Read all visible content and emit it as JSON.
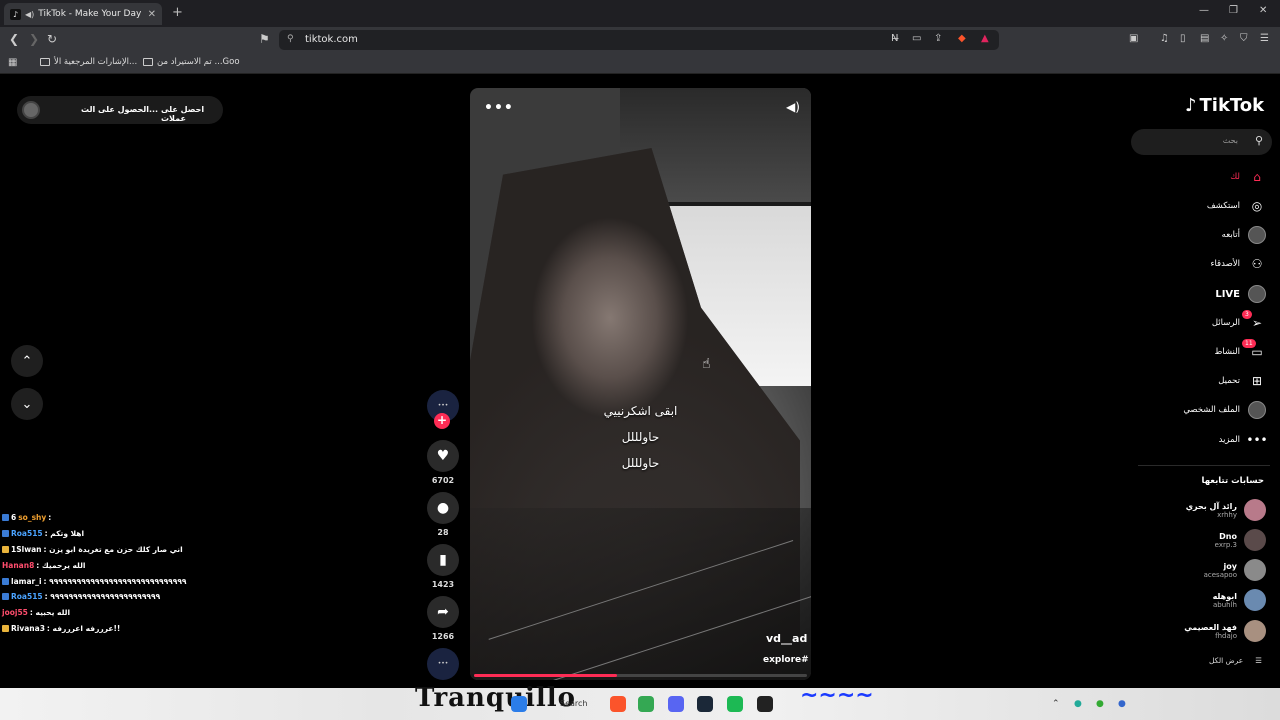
{
  "browser": {
    "tab_title": "TikTok - Make Your Day",
    "new_tab": "+",
    "url": "tiktok.com",
    "window_controls": {
      "minimize": "—",
      "restore": "❐",
      "close": "✕"
    },
    "bookmarks": [
      {
        "label": "تم الاستيراد من ...Goo"
      },
      {
        "label": "الإشارات المرجعية الأ..."
      }
    ]
  },
  "left_panel": {
    "get_coins": "احصل على عملات",
    "get_coins_2": "الحصول على الت...",
    "nav_up": "⌃",
    "nav_down": "⌄"
  },
  "video": {
    "caption_lines": [
      "ابقى اشكرنييي",
      "حاولللل",
      "حاولللل"
    ],
    "author": "vd__ad",
    "tag": "explore#",
    "progress": 0.43,
    "more": "•••"
  },
  "actions": {
    "likes": "6702",
    "comments": "28",
    "saves": "1423",
    "shares": "1266"
  },
  "chat": [
    {
      "prefix": "6",
      "user": "so_shy",
      "user_color": "#f0a030",
      "text": ":",
      "badge": "b1"
    },
    {
      "prefix": "",
      "user": "Roa515",
      "user_color": "#4aa3ff",
      "text": ": اهلا وتكم",
      "badge": "b1"
    },
    {
      "prefix": "",
      "user": "1Slwan",
      "user_color": "#ffffff",
      "text": ": اني صار كلك حزن مع تغريدة ابو يزن",
      "badge": "b2"
    },
    {
      "prefix": "",
      "user": "Hanan8",
      "user_color": "#ff4d6d",
      "text": ": الله يرحميك",
      "badge": ""
    },
    {
      "prefix": "",
      "user": "lamar_i",
      "user_color": "#ffffff",
      "text": ": ٩٩٩٩٩٩٩٩٩٩٩٩٩٩٩٩٩٩٩٩٩٩٩٩٩٩٩٩٩٩",
      "badge": "b1"
    },
    {
      "prefix": "",
      "user": "Roa515",
      "user_color": "#4aa3ff",
      "text": ": ٩٩٩٩٩٩٩٩٩٩٩٩٩٩٩٩٩٩٩٩٩٩٩٩",
      "badge": "b1"
    },
    {
      "prefix": "",
      "user": "jooj55",
      "user_color": "#ff4d6d",
      "text": ": الله يحبيه",
      "badge": ""
    },
    {
      "prefix": "",
      "user": "Rivana3",
      "user_color": "#ffffff",
      "text": ": عرررفه اعرررفه!!",
      "badge": "b2"
    }
  ],
  "sidebar": {
    "logo": "TikTok",
    "search_placeholder": "بحث",
    "nav": [
      {
        "label": "لك",
        "icon": "home-icon",
        "active": true
      },
      {
        "label": "استكشف",
        "icon": "compass-icon"
      },
      {
        "label": "أتابعه",
        "icon": "avatar-icon"
      },
      {
        "label": "الأصدقاء",
        "icon": "friends-icon"
      },
      {
        "label": "LIVE",
        "icon": "live-icon"
      },
      {
        "label": "الرسائل",
        "icon": "messages-icon",
        "badge": "3"
      },
      {
        "label": "النشاط",
        "icon": "activity-icon",
        "badge": "11"
      },
      {
        "label": "تحميل",
        "icon": "upload-icon"
      },
      {
        "label": "الملف الشخصي",
        "icon": "profile-icon"
      },
      {
        "label": "المزيد",
        "icon": "more-icon"
      }
    ],
    "following_title": "حسابات تتابعها",
    "following": [
      {
        "name": "رائد آل بحري",
        "handle": "xrhhy"
      },
      {
        "name": "Dno",
        "handle": "exrp.3"
      },
      {
        "name": "joy",
        "handle": "acesapoo"
      },
      {
        "name": "ابوهله",
        "handle": "abuhlh"
      },
      {
        "name": "فهد العصيمي",
        "handle": "fhdajo"
      }
    ],
    "see_all": "عرض الكل"
  },
  "desktop": {
    "deco_text": "Tranquillo",
    "taskbar_search": "Search"
  }
}
